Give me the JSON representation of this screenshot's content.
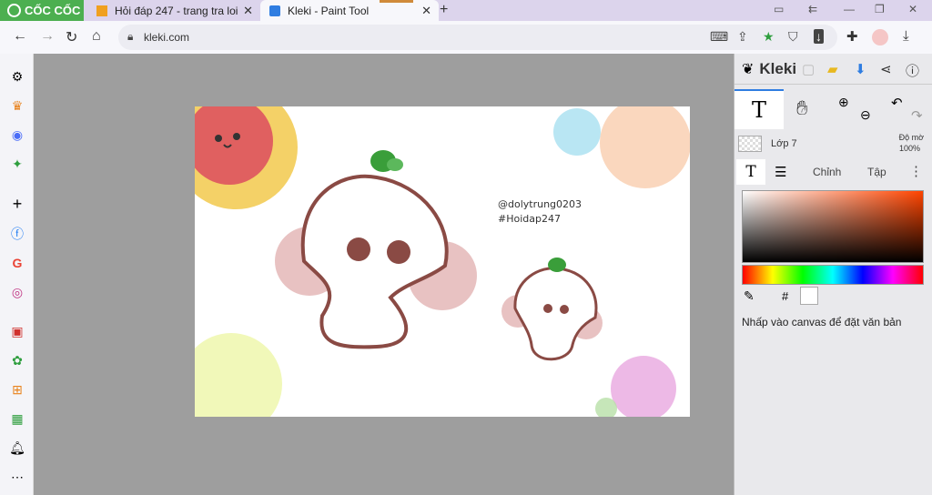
{
  "browser": {
    "brand": "CỐC CỐC",
    "tabs": [
      {
        "label": "Hỏi đáp 247 - trang tra loi"
      },
      {
        "label": "Kleki - Paint Tool"
      }
    ],
    "url": "kleki.com"
  },
  "canvas": {
    "handle": "@dolytrung0203",
    "hashtag": "#Hoidap247"
  },
  "panel": {
    "logo": "Kleki",
    "layer_name": "Lớp 7",
    "opacity_label": "Độ mờ",
    "opacity_value": "100%",
    "subtabs": {
      "adjust": "Chỉnh",
      "file": "Tập"
    },
    "hash_label": "#",
    "hint": "Nhấp vào canvas để đặt văn bản"
  },
  "colors": {
    "brand_green": "#4caf50",
    "accent_blue": "#2f7de1",
    "primary_color": "#ffffff"
  }
}
